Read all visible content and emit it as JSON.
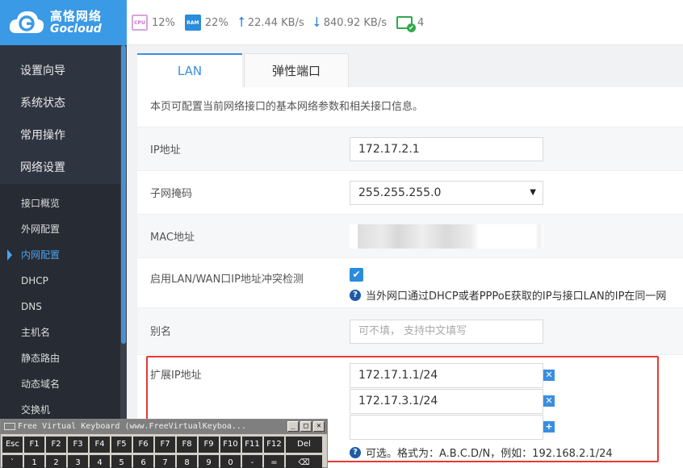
{
  "brand": {
    "name_cn": "高恪网络",
    "name_en": "Gocloud"
  },
  "stats": {
    "cpu_chip": "CPU",
    "cpu": "12%",
    "ram_chip": "RAM",
    "ram": "22%",
    "upload": "22.44 KB/s",
    "download": "840.92 KB/s",
    "devices": "4"
  },
  "sidebar": {
    "main_items": [
      "设置向导",
      "系统状态",
      "常用操作",
      "网络设置"
    ],
    "sub_items": [
      "接口概览",
      "外网配置",
      "内网配置",
      "DHCP",
      "DNS",
      "主机名",
      "静态路由",
      "动态域名",
      "交换机"
    ],
    "active_sub": "内网配置"
  },
  "tabs": {
    "lan": "LAN",
    "elastic": "弹性端口"
  },
  "page": {
    "description": "本页可配置当前网络接口的基本网络参数和相关接口信息。",
    "ip": {
      "label": "IP地址",
      "value": "172.17.2.1"
    },
    "netmask": {
      "label": "子网掩码",
      "value": "255.255.255.0"
    },
    "mac": {
      "label": "MAC地址"
    },
    "conflict": {
      "label": "启用LAN/WAN口IP地址冲突检测",
      "hint": "当外网口通过DHCP或者PPPoE获取的IP与接口LAN的IP在同一网"
    },
    "alias": {
      "label": "别名",
      "placeholder": "可不填， 支持中文填写"
    },
    "ext_ip": {
      "label": "扩展IP地址",
      "values": [
        "172.17.1.1/24",
        "172.17.3.1/24",
        ""
      ],
      "hint": "可选。格式为：A.B.C.D/N，例如：192.168.2.1/24"
    }
  },
  "keyboard": {
    "title": "Free Virtual Keyboard (www.FreeVirtualKeyboa...",
    "ctrl_min": "_",
    "ctrl_max": "□",
    "ctrl_close": "✕",
    "row1": [
      "Esc",
      "F1",
      "F2",
      "F3",
      "F4",
      "F5",
      "F6",
      "F7",
      "F8",
      "F9",
      "F10",
      "F11",
      "F12",
      "Del"
    ],
    "row2": [
      "`",
      "1",
      "2",
      "3",
      "4",
      "5",
      "6",
      "7",
      "8",
      "9",
      "0",
      "-",
      "=",
      "⌫"
    ]
  },
  "colors": {
    "accent": "#3a8ee0",
    "sidebar": "#2f3540",
    "highlight": "#e53935"
  }
}
